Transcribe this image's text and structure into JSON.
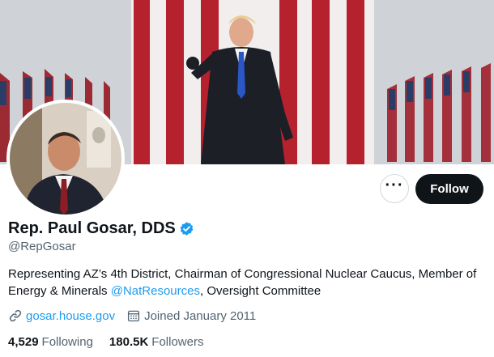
{
  "profile": {
    "display_name": "Rep. Paul Gosar, DDS",
    "handle": "@RepGosar",
    "bio_text_1": "Representing AZ’s 4th District, Chairman of Congressional Nuclear Caucus, Member of Energy & Minerals ",
    "bio_mention": "@NatResources",
    "bio_text_2": ", Oversight Committee",
    "website": "gosar.house.gov",
    "joined": "Joined January 2011"
  },
  "stats": {
    "following_count": "4,529",
    "following_label": "Following",
    "followers_count": "180.5K",
    "followers_label": "Followers"
  },
  "actions": {
    "more_label": "···",
    "follow_label": "Follow"
  },
  "icons": {
    "verified": "verified-badge-icon",
    "link": "link-icon",
    "calendar": "calendar-icon",
    "more": "more-icon"
  },
  "colors": {
    "accent": "#1d9bf0",
    "text_primary": "#0f1419",
    "text_secondary": "#536471",
    "follow_button_bg": "#0f1419"
  }
}
